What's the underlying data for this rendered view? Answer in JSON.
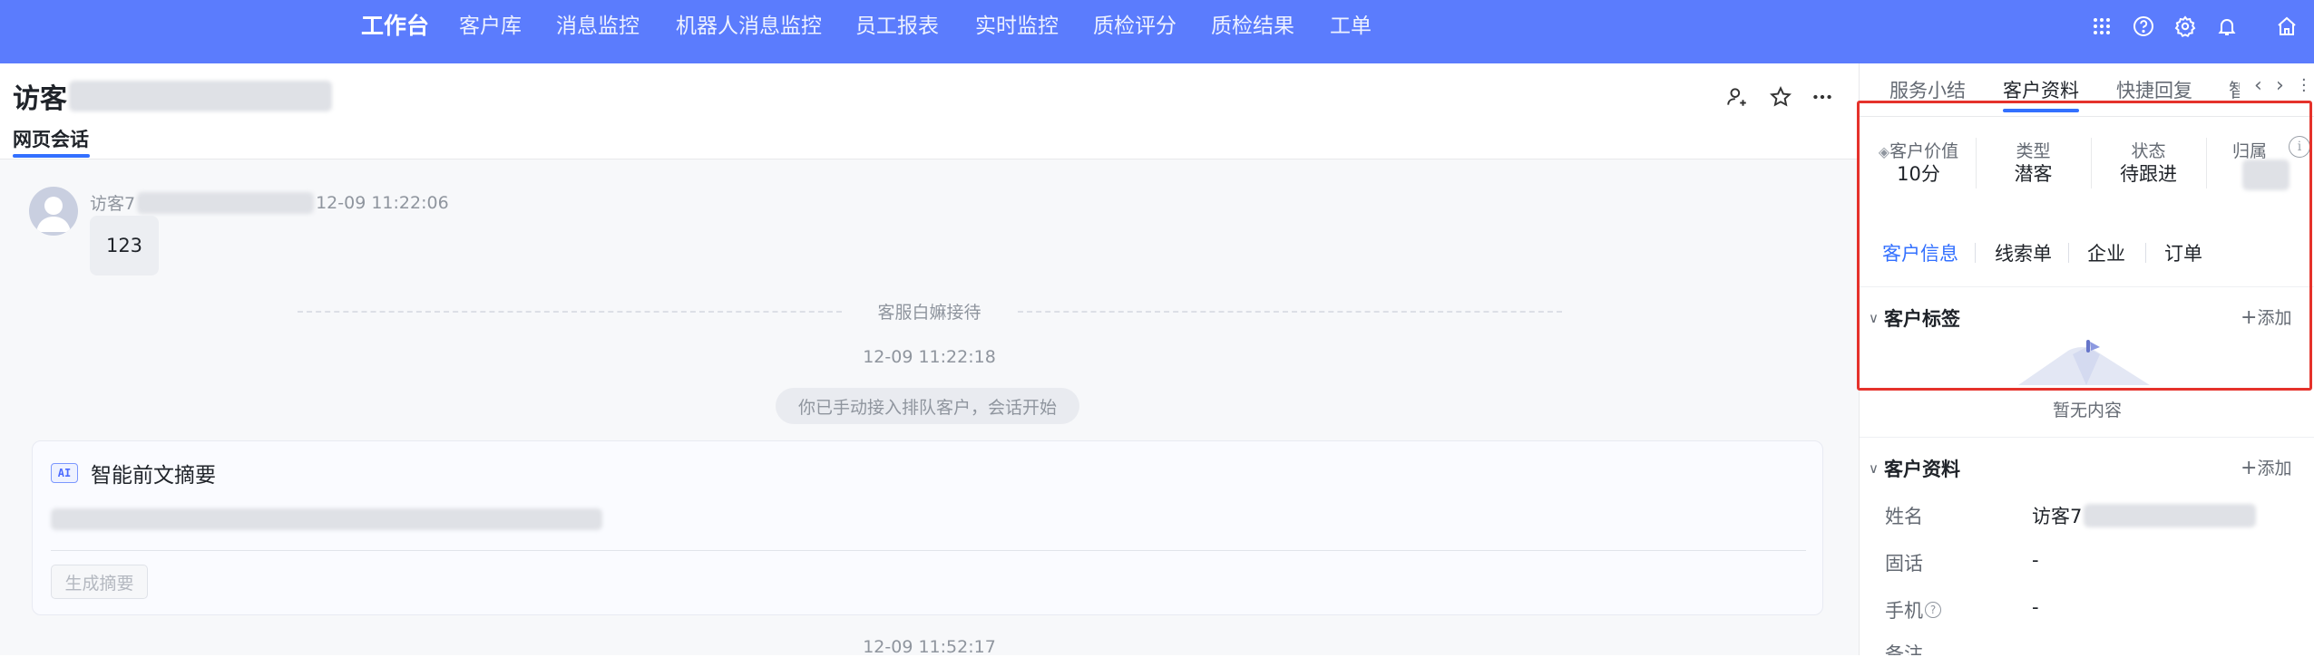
{
  "nav": {
    "items": [
      "工作台",
      "客户库",
      "消息监控",
      "机器人消息监控",
      "员工报表",
      "实时监控",
      "质检评分",
      "质检结果",
      "工单"
    ],
    "active_index": 0,
    "bar_color": "#5b7cfd"
  },
  "top_icons": [
    "apps-grid-icon",
    "help-icon",
    "settings-gear-icon",
    "bell-icon",
    "home-icon"
  ],
  "session": {
    "title": "访客",
    "tab_label": "网页会话"
  },
  "chat": {
    "visitor_prefix": "访客7",
    "first_time": "12-09 11:22:06",
    "first_message": "123",
    "agent_joined": "客服白嫲接待",
    "joined_time": "12-09 11:22:18",
    "system_notice": "你已手动接入排队客户，会话开始",
    "bottom_time": "12-09 11:52:17"
  },
  "ai_summary": {
    "badge": "AI",
    "title": "智能前文摘要",
    "button": "生成摘要"
  },
  "right_panel": {
    "tabs": [
      "服务小结",
      "客户资料",
      "快捷回复",
      "智"
    ],
    "active_tab": 1,
    "stats": [
      {
        "label": "客户价值",
        "value": "10分"
      },
      {
        "label": "类型",
        "value": "潜客"
      },
      {
        "label": "状态",
        "value": "待跟进"
      },
      {
        "label": "归属",
        "value": ""
      }
    ],
    "subtabs": [
      "客户信息",
      "线索单",
      "企业",
      "订单"
    ],
    "active_subtab": 0,
    "tags_section": {
      "title": "客户标签",
      "add": "添加",
      "empty": "暂无内容"
    },
    "profile_section": {
      "title": "客户资料",
      "add": "添加",
      "fields": [
        {
          "label": "姓名",
          "value": "访客7"
        },
        {
          "label": "固话",
          "value": "-"
        },
        {
          "label": "手机",
          "value": "-"
        },
        {
          "label": "备注",
          "value": ""
        }
      ]
    }
  },
  "colors": {
    "accent": "#3370ff",
    "highlight_box": "#e5322b"
  }
}
